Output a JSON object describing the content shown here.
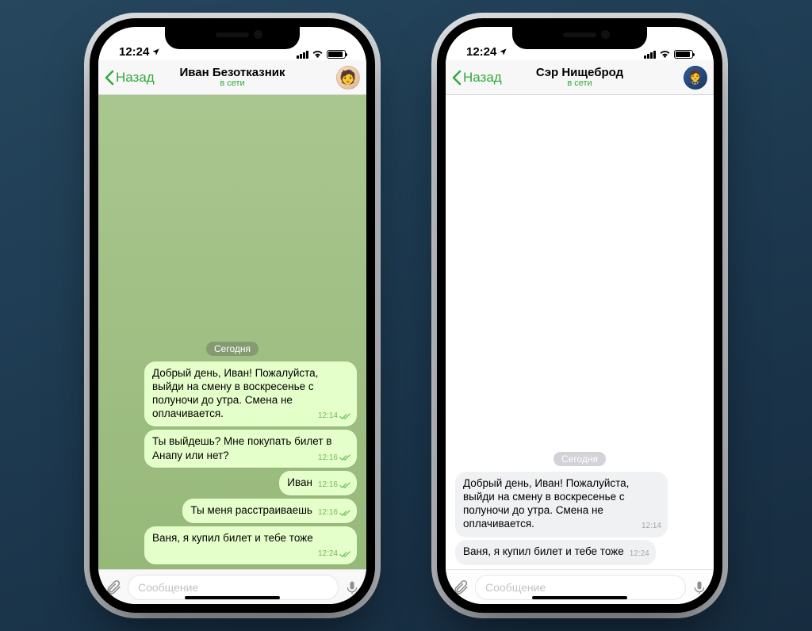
{
  "status_time": "12:24",
  "back_label": "Назад",
  "date_label": "Сегодня",
  "compose_placeholder": "Сообщение",
  "phones": [
    {
      "name": "Иван Безотказник",
      "presence": "в сети",
      "theme": "green",
      "messages": [
        {
          "text": "Добрый день, Иван! Пожалуйста, выйди на смену в воскресенье с полуночи до утра. Смена не оплачивается.",
          "time": "12:14",
          "dir": "out",
          "read": true
        },
        {
          "text": "Ты выйдешь? Мне покупать билет в Анапу или нет?",
          "time": "12:16",
          "dir": "out",
          "read": true
        },
        {
          "text": "Иван",
          "time": "12:16",
          "dir": "out",
          "read": true
        },
        {
          "text": "Ты меня расстраиваешь",
          "time": "12:16",
          "dir": "out",
          "read": true
        },
        {
          "text": "Ваня, я купил билет и тебе тоже",
          "time": "12:24",
          "dir": "out",
          "read": true
        }
      ]
    },
    {
      "name": "Сэр Нищеброд",
      "presence": "в сети",
      "theme": "white",
      "messages": [
        {
          "text": "Добрый день, Иван! Пожалуйста, выйди на смену в воскресенье с полуночи до утра. Смена не оплачивается.",
          "time": "12:14",
          "dir": "in"
        },
        {
          "text": "Ваня, я купил билет и тебе тоже",
          "time": "12:24",
          "dir": "in"
        }
      ]
    }
  ]
}
